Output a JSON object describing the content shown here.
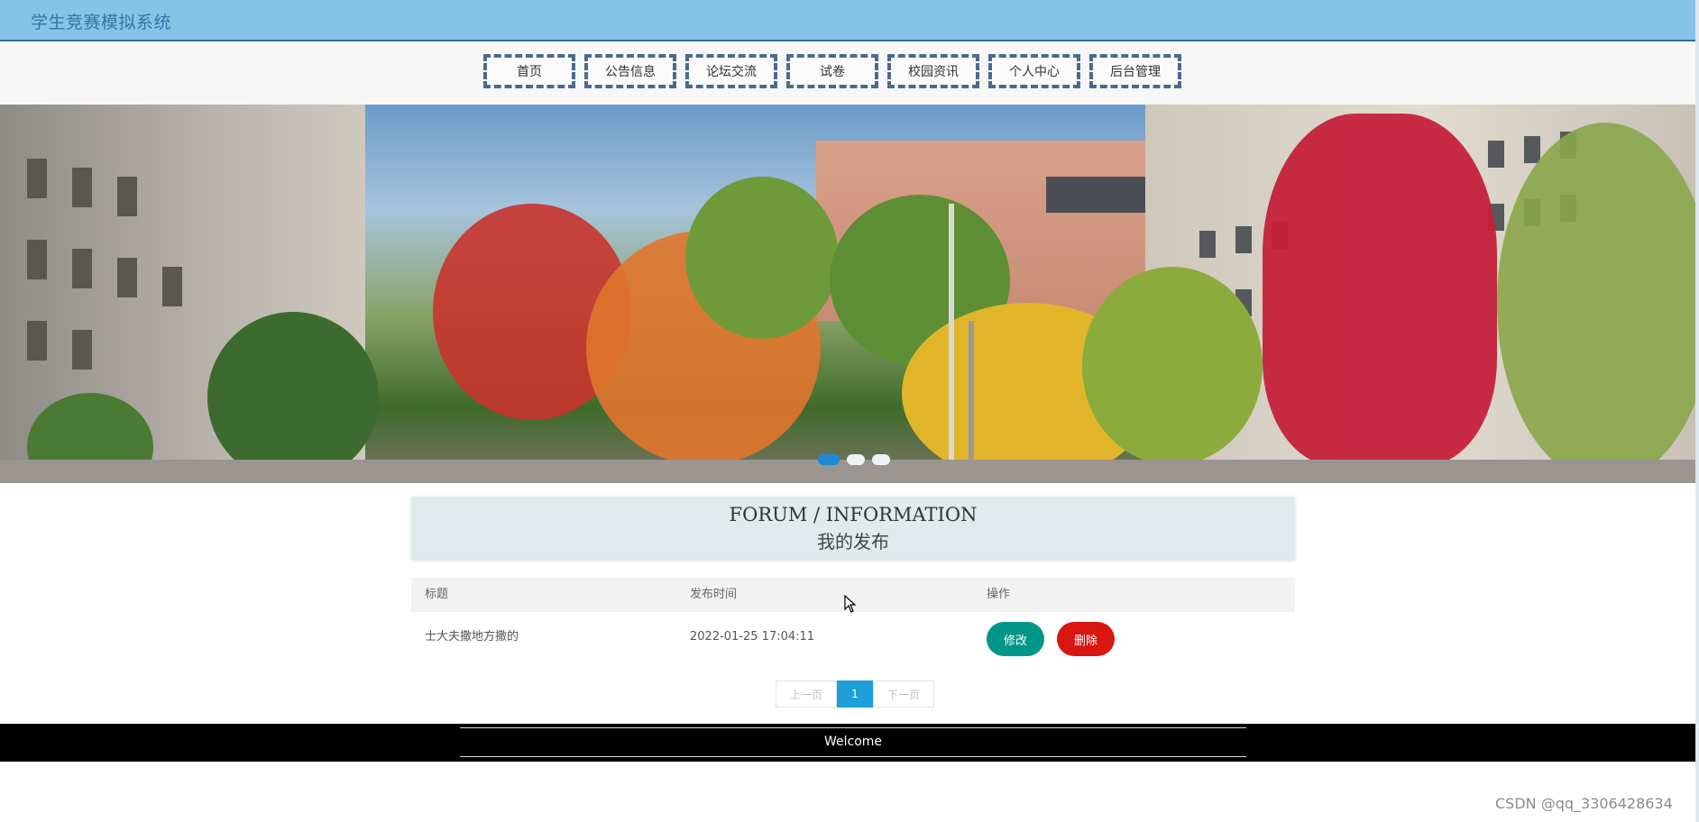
{
  "header": {
    "site_title": "学生竞赛模拟系统"
  },
  "nav": {
    "items": [
      {
        "label": "首页"
      },
      {
        "label": "公告信息"
      },
      {
        "label": "论坛交流"
      },
      {
        "label": "试卷"
      },
      {
        "label": "校园资讯"
      },
      {
        "label": "个人中心"
      },
      {
        "label": "后台管理"
      }
    ]
  },
  "banner": {
    "slides": 3,
    "active_slide": 1,
    "colors": {
      "active_dot": "#1e88d9",
      "inactive_dot": "#eef2f6"
    }
  },
  "section": {
    "title_en": "FORUM / INFORMATION",
    "title_cn": "我的发布"
  },
  "table": {
    "headers": {
      "title": "标题",
      "time": "发布时间",
      "action": "操作"
    },
    "rows": [
      {
        "title": "士大夫撒地方撒的",
        "time": "2022-01-25 17:04:11",
        "edit_label": "修改",
        "delete_label": "删除"
      }
    ]
  },
  "pagination": {
    "prev_label": "上一页",
    "current": "1",
    "next_label": "下一页"
  },
  "footer": {
    "text": "Welcome"
  },
  "watermark": {
    "text": "CSDN @qq_3306428634"
  },
  "colors": {
    "header_bg": "#87c3e6",
    "edit_button": "#009688",
    "delete_button": "#d9160f",
    "page_current": "#1e9fd8"
  }
}
